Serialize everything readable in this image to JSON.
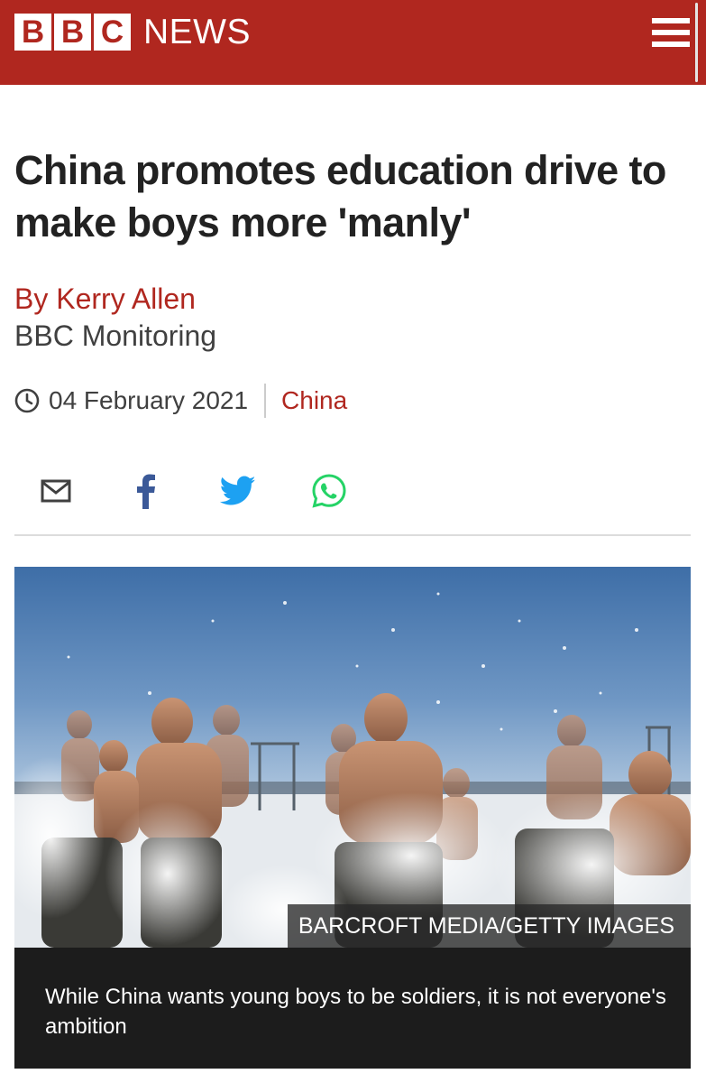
{
  "header": {
    "logo_letters": [
      "B",
      "B",
      "C"
    ],
    "logo_word": "NEWS",
    "menu_icon": "hamburger-menu-icon",
    "brand_color": "#b0271f"
  },
  "article": {
    "headline": "China promotes education drive to make boys more 'manly'",
    "byline": "By Kerry Allen",
    "affiliation": "BBC Monitoring",
    "date": "04 February 2021",
    "topic": "China"
  },
  "share": {
    "icons": [
      "email-icon",
      "facebook-icon",
      "twitter-icon",
      "whatsapp-icon"
    ],
    "colors": {
      "facebook": "#3b5998",
      "twitter": "#1da1f2",
      "whatsapp": "#25d366",
      "email": "#404040"
    }
  },
  "media": {
    "credit": "BARCROFT MEDIA/GETTY IMAGES",
    "caption": "While China wants young boys to be soldiers, it is not everyone's ambition"
  }
}
